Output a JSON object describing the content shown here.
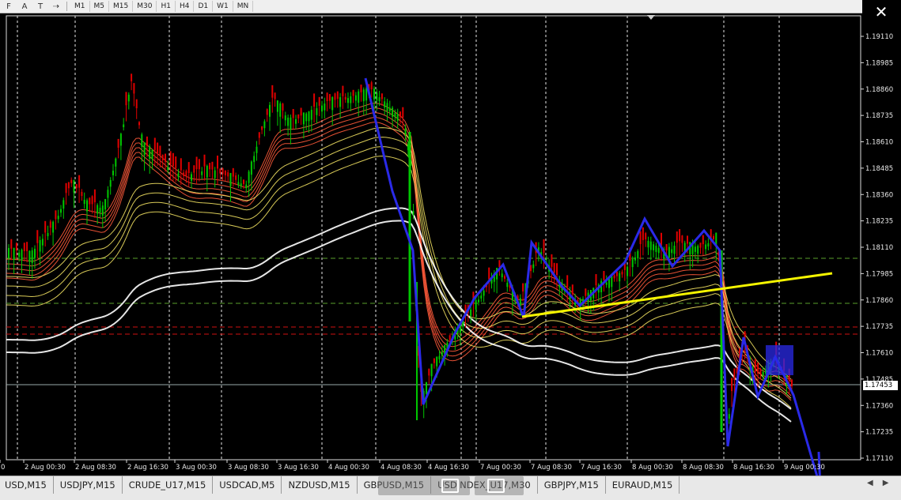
{
  "toolbar": {
    "tools": [
      {
        "icon": "fibo-text-icon",
        "glyph": "F"
      },
      {
        "icon": "text-tool-icon",
        "glyph": "A"
      },
      {
        "icon": "text-label-icon",
        "glyph": "T"
      },
      {
        "icon": "arrows-tool-icon",
        "glyph": "⇢"
      }
    ],
    "timeframes": [
      "M1",
      "M5",
      "M15",
      "M30",
      "H1",
      "H4",
      "D1",
      "W1",
      "MN"
    ]
  },
  "price_scale": {
    "labels": [
      "1.19110",
      "1.18985",
      "1.18860",
      "1.18735",
      "1.18610",
      "1.18485",
      "1.18360",
      "1.18235",
      "1.18110",
      "1.17985",
      "1.17860",
      "1.17735",
      "1.17610",
      "1.17485",
      "1.17360",
      "1.17235",
      "1.17110"
    ],
    "current_price": "1.17453"
  },
  "time_scale": {
    "labels": [
      "0",
      "2 Aug 00:30",
      "2 Aug 08:30",
      "2 Aug 16:30",
      "3 Aug 00:30",
      "3 Aug 08:30",
      "3 Aug 16:30",
      "4 Aug 00:30",
      "4 Aug 08:30",
      "4 Aug 16:30",
      "7 Aug 00:30",
      "7 Aug 08:30",
      "7 Aug 16:30",
      "8 Aug 00:30",
      "8 Aug 08:30",
      "8 Aug 16:30",
      "9 Aug 00:30"
    ]
  },
  "tabs": [
    "USD,M15",
    "USDJPY,M15",
    "CRUDE_U17,M15",
    "USDCAD,M5",
    "NZDUSD,M15",
    "GBPUSD,M15",
    "USDINDEX_U17,M30",
    "GBPJPY,M15",
    "EURAUD,M15"
  ],
  "colors": {
    "background": "#000000",
    "bull_candle": "#00c800",
    "bear_candle": "#e00000",
    "zigzag": "#2a2ae8",
    "trendline": "#f5f500",
    "ema_white": "#ffffff",
    "level_green": "#5aa02c",
    "level_red": "#d01010"
  }
}
